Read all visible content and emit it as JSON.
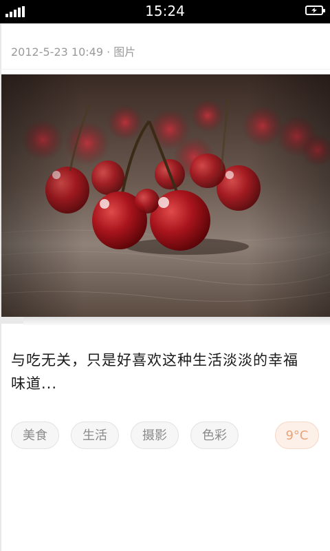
{
  "status_bar": {
    "time": "15:24",
    "icons": [
      "signal-icon",
      "battery-charging-icon"
    ]
  },
  "post": {
    "meta": "2012-5-23 10:49 · 图片",
    "photo_icon": "cherries-photo",
    "caption_line1": "与吃无关，只是好喜欢这种生活淡淡的幸福",
    "caption_line2": "味道..."
  },
  "tags": [
    "美食",
    "生活",
    "摄影",
    "色彩"
  ],
  "weather": {
    "temperature": "9°C"
  },
  "colors": {
    "status_bar_bg": "#000000",
    "tag_bg": "#f6f6f6",
    "tag_text": "#8a8a8a",
    "temp_bg": "#fdf0e8",
    "temp_text": "#e9a27a"
  }
}
